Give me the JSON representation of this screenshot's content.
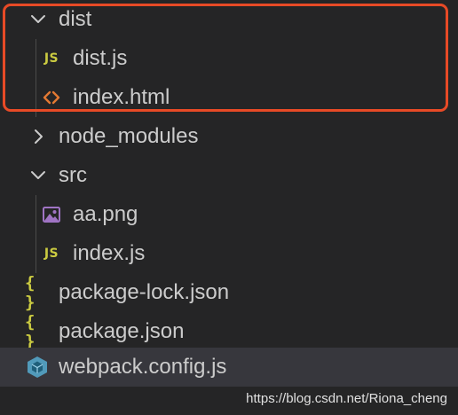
{
  "explorer": {
    "items": [
      {
        "label": "dist",
        "type": "folder",
        "expanded": true,
        "icon": "chevron-down-icon"
      },
      {
        "label": "dist.js",
        "type": "file",
        "icon": "javascript-file-icon",
        "icon_text": "JS"
      },
      {
        "label": "index.html",
        "type": "file",
        "icon": "html-file-icon",
        "icon_text": "<>"
      },
      {
        "label": "node_modules",
        "type": "folder",
        "expanded": false,
        "icon": "chevron-right-icon"
      },
      {
        "label": "src",
        "type": "folder",
        "expanded": true,
        "icon": "chevron-down-icon"
      },
      {
        "label": "aa.png",
        "type": "file",
        "icon": "image-file-icon"
      },
      {
        "label": "index.js",
        "type": "file",
        "icon": "javascript-file-icon",
        "icon_text": "JS"
      },
      {
        "label": "package-lock.json",
        "type": "file",
        "icon": "json-file-icon",
        "icon_text": "{ }"
      },
      {
        "label": "package.json",
        "type": "file",
        "icon": "json-file-icon",
        "icon_text": "{ }"
      },
      {
        "label": "webpack.config.js",
        "type": "file",
        "icon": "webpack-config-icon",
        "selected": true
      }
    ]
  },
  "watermark": "https://blog.csdn.net/Riona_cheng",
  "colors": {
    "background": "#252526",
    "selected_row": "#37373d",
    "text": "#cccccc",
    "js_icon": "#cbcb41",
    "json_icon": "#cbcb41",
    "html_icon": "#e37933",
    "image_icon": "#a074c4",
    "webpack_icon": "#519aba",
    "highlight_border": "#e84a26"
  }
}
